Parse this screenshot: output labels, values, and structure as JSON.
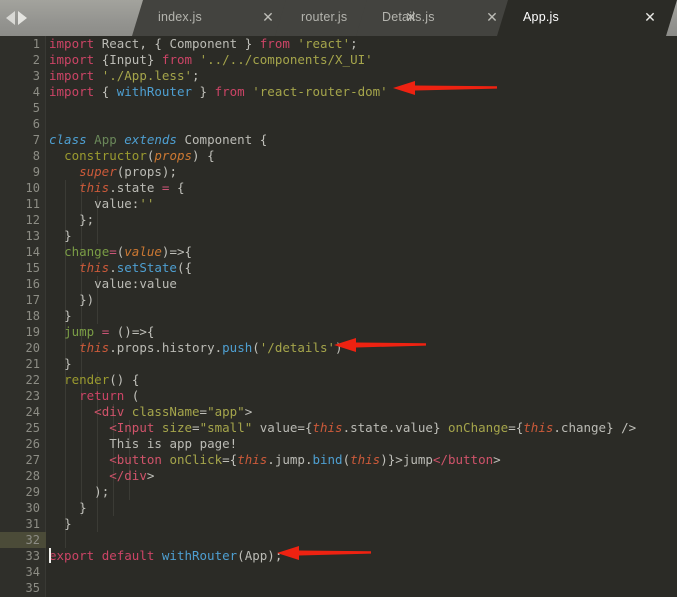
{
  "window": {
    "title": "App.js",
    "background_color": "#2b2b26",
    "tabbar_color": "#999993"
  },
  "tabbar": {
    "nav_back_label": "Back",
    "nav_forward_label": "Forward",
    "close_glyph": "✕",
    "tabs": [
      {
        "label": "index.js",
        "active": false
      },
      {
        "label": "router.js",
        "active": false
      },
      {
        "label": "Details.js",
        "active": false
      },
      {
        "label": "App.js",
        "active": true
      }
    ]
  },
  "editor": {
    "language": "javascript",
    "filename": "App.js",
    "total_lines": 35,
    "current_line": 32,
    "cursor_column": 1,
    "first_line_number": 1,
    "line_height_px": 16,
    "theme": "darcula",
    "gutter_highlight_color": "#4b4b38",
    "lines": [
      {
        "n": 1,
        "text": "import React, { Component } from 'react';"
      },
      {
        "n": 2,
        "text": "import {Input} from '../../components/X_UI'"
      },
      {
        "n": 3,
        "text": "import './App.less';"
      },
      {
        "n": 4,
        "text": "import { withRouter } from 'react-router-dom'"
      },
      {
        "n": 5,
        "text": ""
      },
      {
        "n": 6,
        "text": ""
      },
      {
        "n": 7,
        "text": "class App extends Component {"
      },
      {
        "n": 8,
        "text": "  constructor(props) {"
      },
      {
        "n": 9,
        "text": "    super(props);"
      },
      {
        "n": 10,
        "text": "    this.state = {"
      },
      {
        "n": 11,
        "text": "      value:''"
      },
      {
        "n": 12,
        "text": "    };"
      },
      {
        "n": 13,
        "text": "  }"
      },
      {
        "n": 14,
        "text": "  change=(value)=>{"
      },
      {
        "n": 15,
        "text": "    this.setState({"
      },
      {
        "n": 16,
        "text": "      value:value"
      },
      {
        "n": 17,
        "text": "    })"
      },
      {
        "n": 18,
        "text": "  }"
      },
      {
        "n": 19,
        "text": "  jump = ()=>{"
      },
      {
        "n": 20,
        "text": "    this.props.history.push('/details')"
      },
      {
        "n": 21,
        "text": "  }"
      },
      {
        "n": 22,
        "text": "  render() {"
      },
      {
        "n": 23,
        "text": "    return ("
      },
      {
        "n": 24,
        "text": "      <div className=\"app\">"
      },
      {
        "n": 25,
        "text": "        <Input size=\"small\" value={this.state.value} onChange={this.change} />"
      },
      {
        "n": 26,
        "text": "        This is app page!"
      },
      {
        "n": 27,
        "text": "        <button onClick={this.jump.bind(this)}>jump</button>"
      },
      {
        "n": 28,
        "text": "        </div>"
      },
      {
        "n": 29,
        "text": "      );"
      },
      {
        "n": 30,
        "text": "    }"
      },
      {
        "n": 31,
        "text": "  }"
      },
      {
        "n": 32,
        "text": ""
      },
      {
        "n": 33,
        "text": "export default withRouter(App);"
      },
      {
        "n": 34,
        "text": ""
      },
      {
        "n": 35,
        "text": ""
      }
    ]
  },
  "annotations": {
    "color": "#ee2211",
    "arrows": [
      {
        "name": "arrow-import-withrouter",
        "points_at_line": 4,
        "label": ""
      },
      {
        "name": "arrow-history-push",
        "points_at_line": 20,
        "label": ""
      },
      {
        "name": "arrow-export-withrouter",
        "points_at_line": 33,
        "label": ""
      }
    ]
  }
}
